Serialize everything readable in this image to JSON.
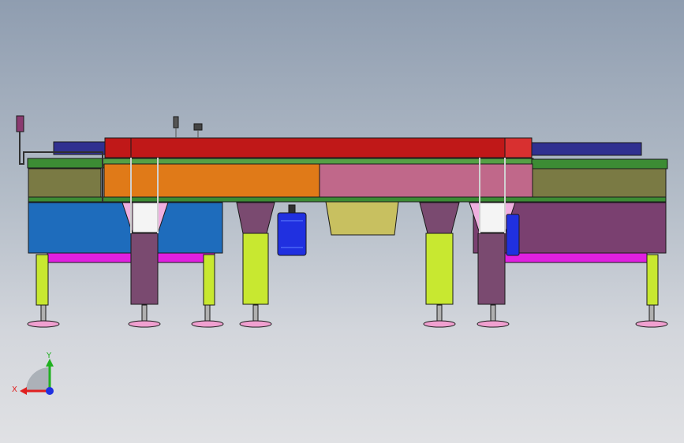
{
  "triad": {
    "x_label": "X",
    "y_label": "Y",
    "x_color": "#e02020",
    "y_color": "#20b020",
    "z_color": "#2030e0"
  },
  "colors": {
    "top_rail": "#c01818",
    "top_rail_cap": "#d83030",
    "orange_panel": "#e07a18",
    "pink_panel": "#c0688a",
    "left_cover": "#1e6cbc",
    "right_cover": "#7a4070",
    "olive_box": "#7a7a44",
    "dark_purple_cover": "#303090",
    "green_strip": "#3c8c34",
    "magenta_bar": "#e020e0",
    "leg_lime": "#c8e830",
    "leg_purple": "#7a4a70",
    "motor_blue": "#2030e0",
    "khaki_plate": "#c8c060",
    "foot_pad": "#f0a0d0"
  },
  "icons": {
    "motor": "motor-icon",
    "sensor": "sensor-icon",
    "triad": "axis-triad-icon"
  }
}
